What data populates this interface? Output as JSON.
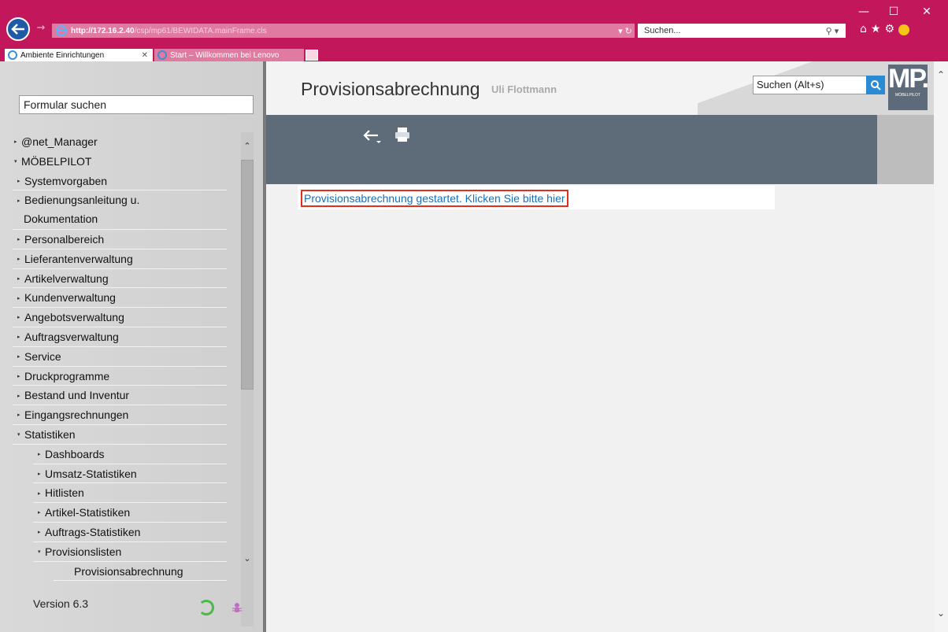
{
  "browser": {
    "url_host": "http://172.16.2.40",
    "url_path": "/csp/mp61/BEWIDATA.mainFrame.cls",
    "search_placeholder": "Suchen...",
    "tabs": [
      {
        "label": "Ambiente Einrichtungen",
        "active": true
      },
      {
        "label": "Start – Willkommen bei Lenovo",
        "active": false
      }
    ],
    "window_controls": {
      "minimize": "—",
      "maximize": "☐",
      "close": "✕"
    },
    "icons": [
      "home-icon",
      "star-icon",
      "gear-icon",
      "smiley-icon"
    ]
  },
  "sidebar": {
    "form_search_value": "Formular suchen",
    "version": "Version 6.3",
    "tree": [
      {
        "label": "@net_Manager",
        "expanded": false,
        "level": 0
      },
      {
        "label": "MÖBELPILOT",
        "expanded": true,
        "level": 0
      },
      {
        "label": "Systemvorgaben",
        "expanded": false,
        "level": 1
      },
      {
        "label": "Bedienungsanleitung u.",
        "label2": "Dokumentation",
        "expanded": false,
        "level": 1
      },
      {
        "label": "Personalbereich",
        "expanded": false,
        "level": 1
      },
      {
        "label": "Lieferantenverwaltung",
        "expanded": false,
        "level": 1
      },
      {
        "label": "Artikelverwaltung",
        "expanded": false,
        "level": 1
      },
      {
        "label": "Kundenverwaltung",
        "expanded": false,
        "level": 1
      },
      {
        "label": "Angebotsverwaltung",
        "expanded": false,
        "level": 1
      },
      {
        "label": "Auftragsverwaltung",
        "expanded": false,
        "level": 1
      },
      {
        "label": "Service",
        "expanded": false,
        "level": 1
      },
      {
        "label": "Druckprogramme",
        "expanded": false,
        "level": 1
      },
      {
        "label": "Bestand und Inventur",
        "expanded": false,
        "level": 1
      },
      {
        "label": "Eingangsrechnungen",
        "expanded": false,
        "level": 1
      },
      {
        "label": "Statistiken",
        "expanded": true,
        "level": 1
      },
      {
        "label": "Dashboards",
        "expanded": false,
        "level": 2
      },
      {
        "label": "Umsatz-Statistiken",
        "expanded": false,
        "level": 2
      },
      {
        "label": "Hitlisten",
        "expanded": false,
        "level": 2
      },
      {
        "label": "Artikel-Statistiken",
        "expanded": false,
        "level": 2
      },
      {
        "label": "Auftrags-Statistiken",
        "expanded": false,
        "level": 2
      },
      {
        "label": "Provisionslisten",
        "expanded": true,
        "level": 2
      },
      {
        "label": "Provisionsabrechnung",
        "expanded": null,
        "level": 3
      }
    ]
  },
  "main": {
    "title": "Provisionsabrechnung",
    "user": "Uli Flottmann",
    "quick_search_value": "Suchen (Alt+s)",
    "logo": {
      "text": "MP.",
      "subtitle": "MÖBELPILOT"
    },
    "toolbar": [
      "back-arrow-icon",
      "print-icon"
    ],
    "message_link": "Provisionsabrechnung gestartet. Klicken Sie bitte hier"
  },
  "colors": {
    "chrome": "#c2185b",
    "toolbar": "#5e6b79",
    "link": "#1a6fb5",
    "highlight": "#e0301e"
  }
}
